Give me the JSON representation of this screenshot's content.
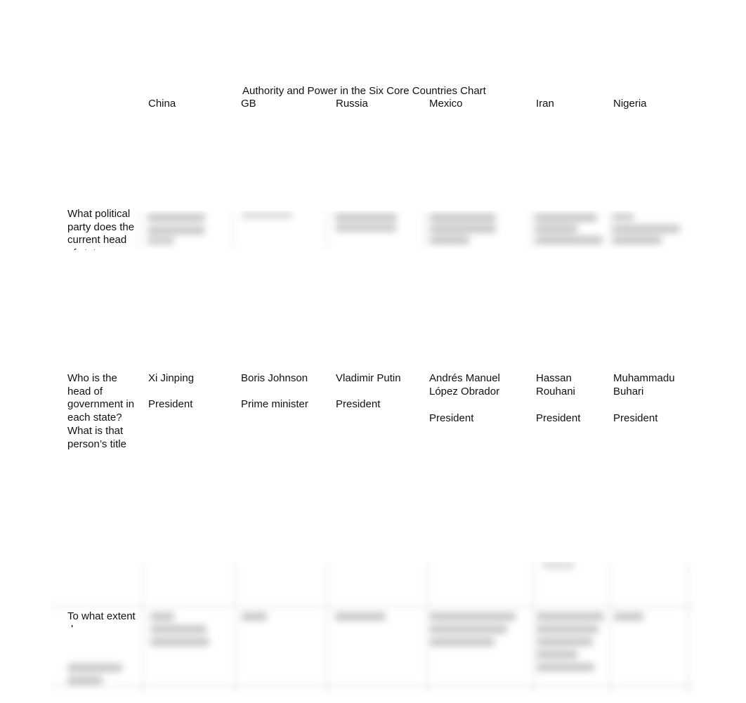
{
  "document": {
    "title": "Authority and Power in the Six Core Countries Chart",
    "columns": [
      "China",
      "GB",
      "Russia",
      "Mexico",
      "Iran",
      "Nigeria"
    ],
    "rows": [
      {
        "question": "What political party does the current head of state",
        "answers_blurred": true
      },
      {
        "question": "Who is the head of government in each state? What is that person’s title",
        "answers": [
          {
            "name": "Xi Jinping",
            "title": "President"
          },
          {
            "name": "Boris Johnson",
            "title": "Prime minister"
          },
          {
            "name": "Vladimir Putin",
            "title": "President"
          },
          {
            "name": "Andrés Manuel López Obrador",
            "title": "President"
          },
          {
            "name": "Hassan Rouhani",
            "title": "President"
          },
          {
            "name": "Muhammadu Buhari",
            "title": "President"
          }
        ]
      },
      {
        "question": "To what extent does",
        "answers_blurred": true
      }
    ]
  }
}
